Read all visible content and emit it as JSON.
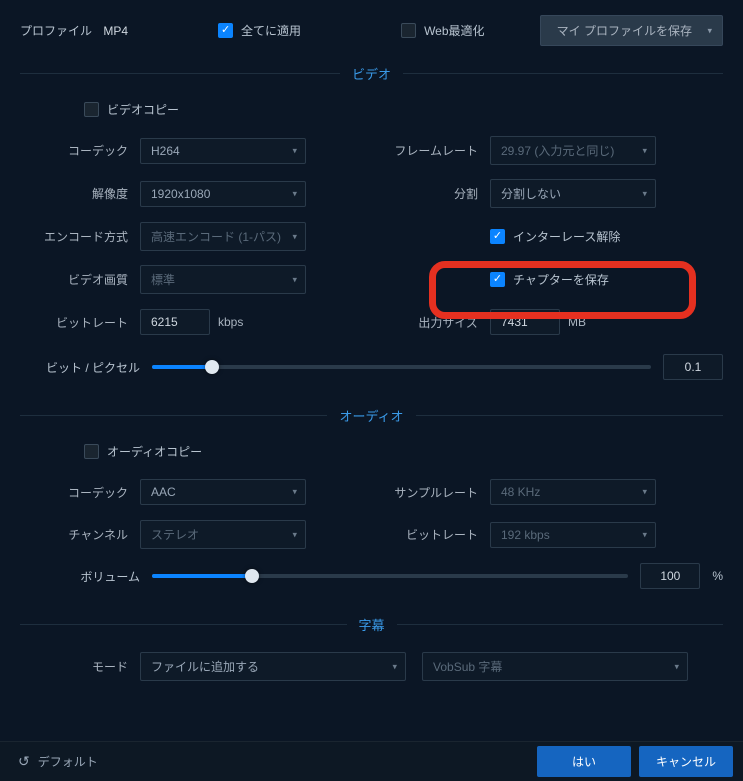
{
  "header": {
    "profile_label": "プロファイル",
    "profile_value": "MP4",
    "apply_all": "全てに適用",
    "web_optimize": "Web最適化",
    "save_profile": "マイ プロファイルを保存"
  },
  "video": {
    "section_title": "ビデオ",
    "video_copy": "ビデオコピー",
    "codec_label": "コーデック",
    "codec_value": "H264",
    "framerate_label": "フレームレート",
    "framerate_value": "29.97 (入力元と同じ)",
    "resolution_label": "解像度",
    "resolution_value": "1920x1080",
    "split_label": "分割",
    "split_value": "分割しない",
    "encode_label": "エンコード方式",
    "encode_value": "高速エンコード (1-パス)",
    "deinterlace": "インターレース解除",
    "quality_label": "ビデオ画質",
    "quality_value": "標準",
    "save_chapter": "チャプターを保存",
    "bitrate_label": "ビットレート",
    "bitrate_value": "6215",
    "bitrate_unit": "kbps",
    "output_label": "出力サイズ",
    "output_value": "7431",
    "output_unit": "MB",
    "bpp_label": "ビット / ピクセル",
    "bpp_value": "0.1",
    "bpp_slider_percent": 12
  },
  "audio": {
    "section_title": "オーディオ",
    "audio_copy": "オーディオコピー",
    "codec_label": "コーデック",
    "codec_value": "AAC",
    "samplerate_label": "サンプルレート",
    "samplerate_value": "48 KHz",
    "channel_label": "チャンネル",
    "channel_value": "ステレオ",
    "bitrate_label": "ビットレート",
    "bitrate_value": "192 kbps",
    "volume_label": "ボリューム",
    "volume_value": "100",
    "volume_unit": "%",
    "volume_slider_percent": 21
  },
  "subtitle": {
    "section_title": "字幕",
    "mode_label": "モード",
    "mode_value": "ファイルに追加する",
    "type_value": "VobSub 字幕"
  },
  "footer": {
    "default": "デフォルト",
    "ok": "はい",
    "cancel": "キャンセル"
  }
}
